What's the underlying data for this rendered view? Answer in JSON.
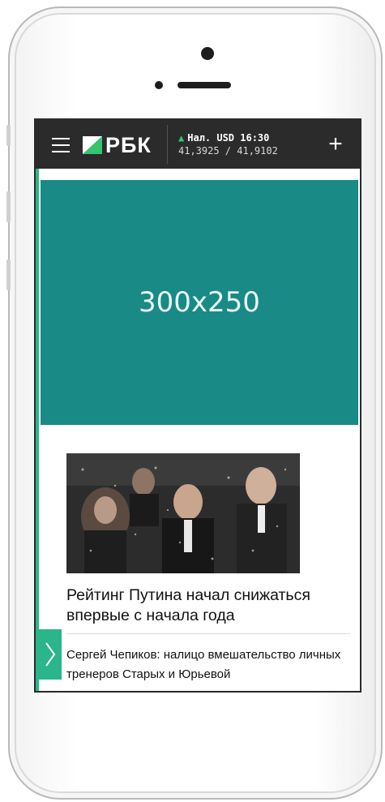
{
  "header": {
    "logo_text": "РБК",
    "rates_label": "Нал. USD 16:30",
    "rates_values": "41,3925 / 41,9102",
    "rates_trend": "▲",
    "plus_symbol": "+"
  },
  "ad": {
    "size_label": "300x250"
  },
  "articles": [
    {
      "title": "Рейтинг Путина начал снижаться впервые с начала года"
    },
    {
      "title": "Сергей Чепиков: налицо вмешательство личных тренеров Старых и Юрьевой"
    }
  ],
  "colors": {
    "topbar": "#2b2b2b",
    "accent_green": "#2ab58a",
    "ad_teal": "#198a86"
  },
  "icons": [
    "menu-icon",
    "logo-mark-icon",
    "plus-icon",
    "chevron-right-icon"
  ]
}
